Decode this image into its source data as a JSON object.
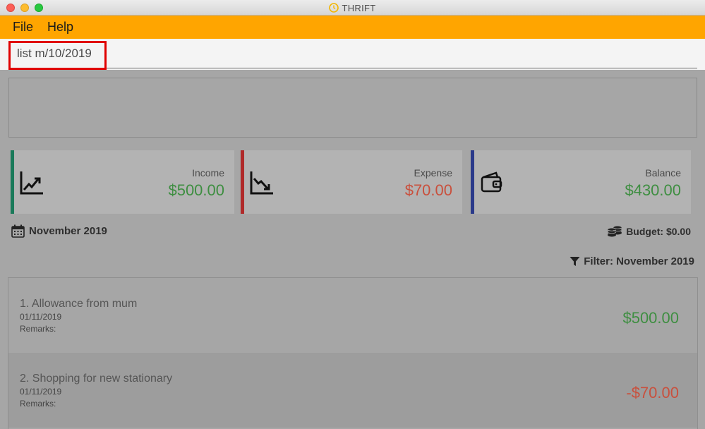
{
  "window": {
    "title": "THRIFT"
  },
  "menu": {
    "file_label": "File",
    "help_label": "Help"
  },
  "command_box": {
    "value": "list m/10/2019"
  },
  "stats": {
    "income": {
      "label": "Income",
      "value": "$500.00",
      "color": "#3e8e41",
      "bar_color": "#1a7a5a"
    },
    "expense": {
      "label": "Expense",
      "value": "$70.00",
      "color": "#c9503d",
      "bar_color": "#b02a2a"
    },
    "balance": {
      "label": "Balance",
      "value": "$430.00",
      "color": "#3e8e41",
      "bar_color": "#2a3a8a"
    }
  },
  "current_month": {
    "text": "November 2019",
    "icon": "calendar-icon"
  },
  "budget": {
    "text": "Budget: $0.00",
    "icon": "coins-icon"
  },
  "filter": {
    "text": "Filter: November 2019",
    "icon": "filter-icon"
  },
  "transactions": [
    {
      "title": "1.  Allowance from mum",
      "date": "01/11/2019",
      "remarks": "Remarks:",
      "value": "$500.00",
      "color": "#3e8e41"
    },
    {
      "title": "2.  Shopping for new stationary",
      "date": "01/11/2019",
      "remarks": "Remarks:",
      "value": "-$70.00",
      "color": "#c9503d"
    }
  ],
  "colors": {
    "accent": "#ffa500",
    "highlight": "#e00000"
  }
}
